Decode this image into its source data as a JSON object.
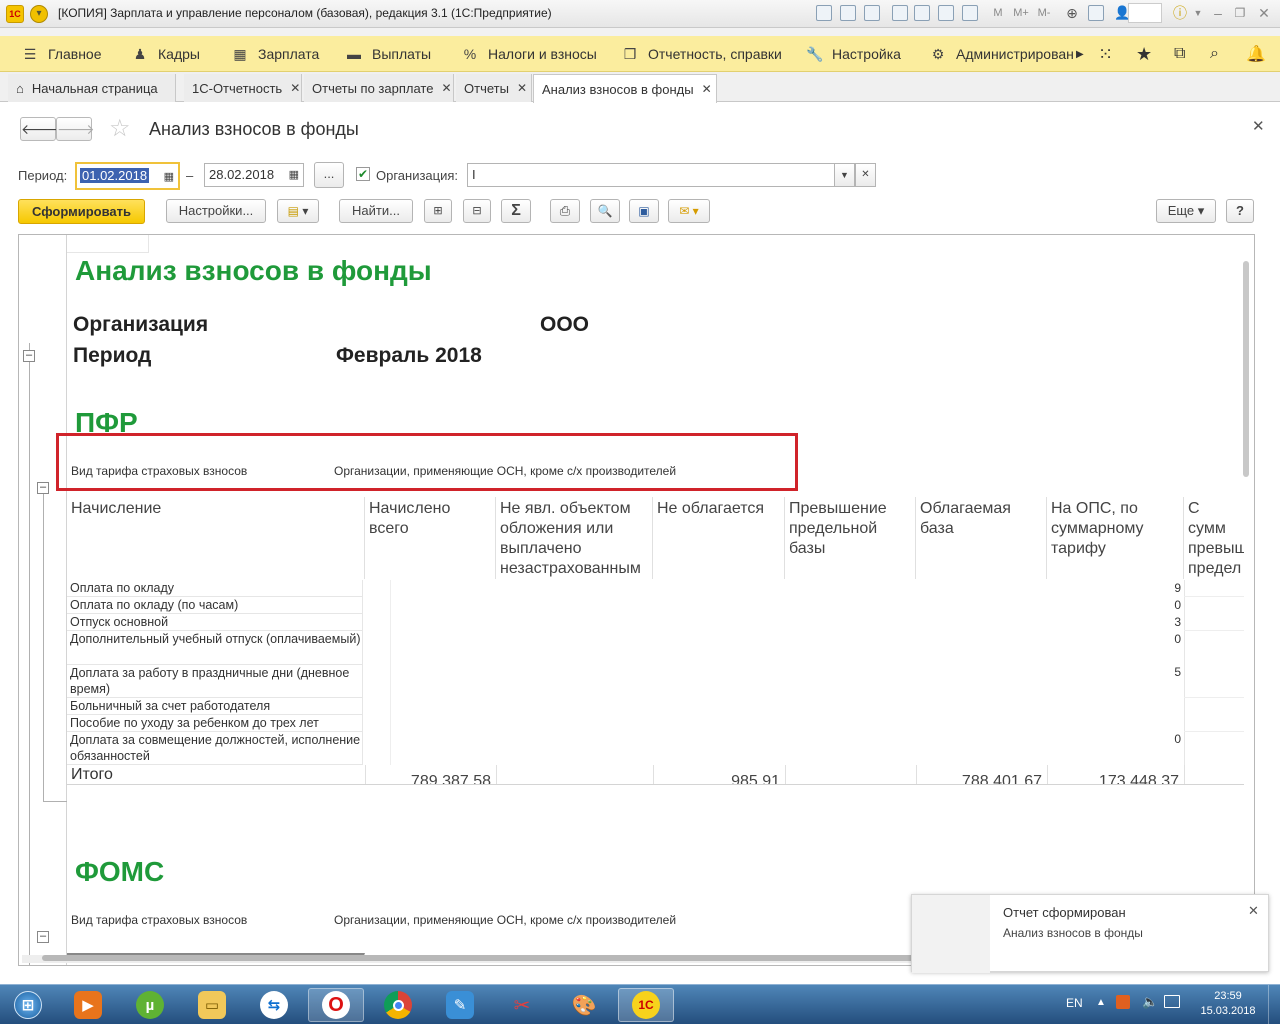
{
  "window": {
    "title": "[КОПИЯ] Зарплата и управление персоналом (базовая), редакция 3.1  (1С:Предприятие)",
    "logo_text": "1С",
    "toolbar_text": {
      "m": "M",
      "mplus": "M+",
      "mminus": "M-"
    }
  },
  "menu": [
    {
      "label": "Главное",
      "icon": "hamburger-icon"
    },
    {
      "label": "Кадры",
      "icon": "people-icon"
    },
    {
      "label": "Зарплата",
      "icon": "calculator-icon"
    },
    {
      "label": "Выплаты",
      "icon": "wallet-icon"
    },
    {
      "label": "Налоги и взносы",
      "icon": "percent-icon"
    },
    {
      "label": "Отчетность, справки",
      "icon": "report-icon"
    },
    {
      "label": "Настройка",
      "icon": "wrench-icon"
    },
    {
      "label": "Администрирован",
      "icon": "gear-icon"
    }
  ],
  "tabs": [
    {
      "label": "Начальная страница",
      "closable": false
    },
    {
      "label": "1С-Отчетность",
      "closable": true
    },
    {
      "label": "Отчеты по зарплате",
      "closable": true
    },
    {
      "label": "Отчеты",
      "closable": true
    },
    {
      "label": "Анализ взносов в фонды",
      "closable": true,
      "active": true
    }
  ],
  "form": {
    "title": "Анализ взносов в фонды",
    "period_label": "Период:",
    "date_from": "01.02.2018",
    "date_dash": "–",
    "date_to": "28.02.2018",
    "ellipsis": "...",
    "org_checked": true,
    "org_label": "Организация:",
    "org_value": "I"
  },
  "buttons": {
    "generate": "Сформировать",
    "settings": "Настройки...",
    "find": "Найти...",
    "sum": "Σ",
    "more": "Еще",
    "help": "?"
  },
  "report": {
    "title": "Анализ взносов в фонды",
    "org_label": "Организация",
    "org_value": "ООО",
    "period_label": "Период",
    "period_value": "Февраль 2018",
    "pfr": {
      "heading": "ПФР",
      "tariff_label": "Вид тарифа страховых взносов",
      "tariff_value": "Организации, применяющие ОСН, кроме с/х производителей"
    },
    "columns": [
      "Начисление",
      "Начислено всего",
      "Не явл. объектом обложения или выплачено незастрахованным",
      "Не облагается",
      "Превышение предельной базы",
      "Облагаемая база",
      "На ОПС, по суммарному тарифу",
      "С сумм превыш предел базы"
    ],
    "rows": [
      {
        "label": "Оплата по окладу",
        "tail": "9"
      },
      {
        "label": "Оплата по окладу (по часам)",
        "tail": "0"
      },
      {
        "label": "Отпуск основной",
        "tail": "3"
      },
      {
        "label": "Дополнительный учебный отпуск (оплачиваемый)",
        "tail": "0"
      },
      {
        "label": "Доплата за работу в праздничные дни (дневное время)",
        "tail": "5"
      },
      {
        "label": "Больничный за счет работодателя",
        "tail": ""
      },
      {
        "label": "Пособие по уходу за ребенком до трех лет",
        "tail": ""
      },
      {
        "label": "Доплата за совмещение должностей, исполнение обязанностей",
        "tail": "0"
      }
    ],
    "total": {
      "label": "Итого",
      "accrued": "789 387,58",
      "not_taxed": "985,91",
      "taxable": "788 401,67",
      "ops": "173 448,37"
    },
    "foms": {
      "heading": "ФОМС",
      "tariff_label": "Вид тарифа страховых взносов",
      "tariff_value": "Организации, применяющие ОСН, кроме с/х производителей"
    }
  },
  "notification": {
    "title": "Отчет сформирован",
    "text": "Анализ взносов в фонды"
  },
  "taskbar": {
    "lang": "EN",
    "time": "23:59",
    "date": "15.03.2018",
    "apps": [
      "start",
      "media-player",
      "utorrent",
      "explorer",
      "teamviewer",
      "opera",
      "chrome",
      "draw",
      "scissors",
      "paint",
      "1c"
    ]
  },
  "colors": {
    "menu_bg": "#fbed9e",
    "accent": "#f6c800",
    "report_heading": "#1f9a3a",
    "highlight_box": "#d0232a"
  }
}
